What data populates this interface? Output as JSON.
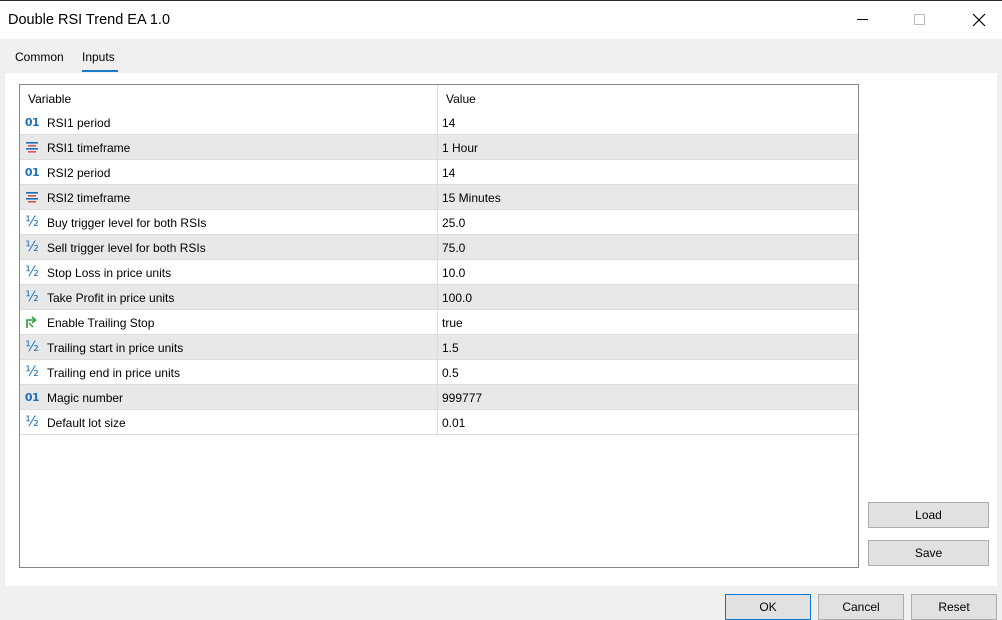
{
  "window": {
    "title": "Double RSI Trend EA 1.0"
  },
  "tabs": [
    {
      "label": "Common",
      "active": false
    },
    {
      "label": "Inputs",
      "active": true
    }
  ],
  "grid": {
    "columns": {
      "variable": "Variable",
      "value": "Value"
    },
    "rows": [
      {
        "icon": "integer-icon",
        "variable": "RSI1 period",
        "value": "14"
      },
      {
        "icon": "enum-icon",
        "variable": "RSI1 timeframe",
        "value": "1 Hour"
      },
      {
        "icon": "integer-icon",
        "variable": "RSI2 period",
        "value": "14"
      },
      {
        "icon": "enum-icon",
        "variable": "RSI2 timeframe",
        "value": "15 Minutes"
      },
      {
        "icon": "fraction-icon",
        "variable": "Buy trigger level for both RSIs",
        "value": "25.0"
      },
      {
        "icon": "fraction-icon",
        "variable": "Sell trigger level for both RSIs",
        "value": "75.0"
      },
      {
        "icon": "fraction-icon",
        "variable": "Stop Loss in price units",
        "value": "10.0"
      },
      {
        "icon": "fraction-icon",
        "variable": "Take Profit in price units",
        "value": "100.0"
      },
      {
        "icon": "boolean-icon",
        "variable": "Enable Trailing Stop",
        "value": "true"
      },
      {
        "icon": "fraction-icon",
        "variable": "Trailing start in price units",
        "value": "1.5"
      },
      {
        "icon": "fraction-icon",
        "variable": "Trailing end in price units",
        "value": "0.5"
      },
      {
        "icon": "integer-icon",
        "variable": "Magic number",
        "value": "999777"
      },
      {
        "icon": "fraction-icon",
        "variable": "Default lot size",
        "value": "0.01"
      }
    ]
  },
  "side_buttons": {
    "load": "Load",
    "save": "Save"
  },
  "footer": {
    "ok": "OK",
    "cancel": "Cancel",
    "reset": "Reset"
  },
  "colors": {
    "accent": "#1e7bc9",
    "icon_blue": "#1e6fb8",
    "enum_red": "#d9534f",
    "bool_green": "#2e9e3e",
    "alt_row": "#e8e8e8"
  }
}
